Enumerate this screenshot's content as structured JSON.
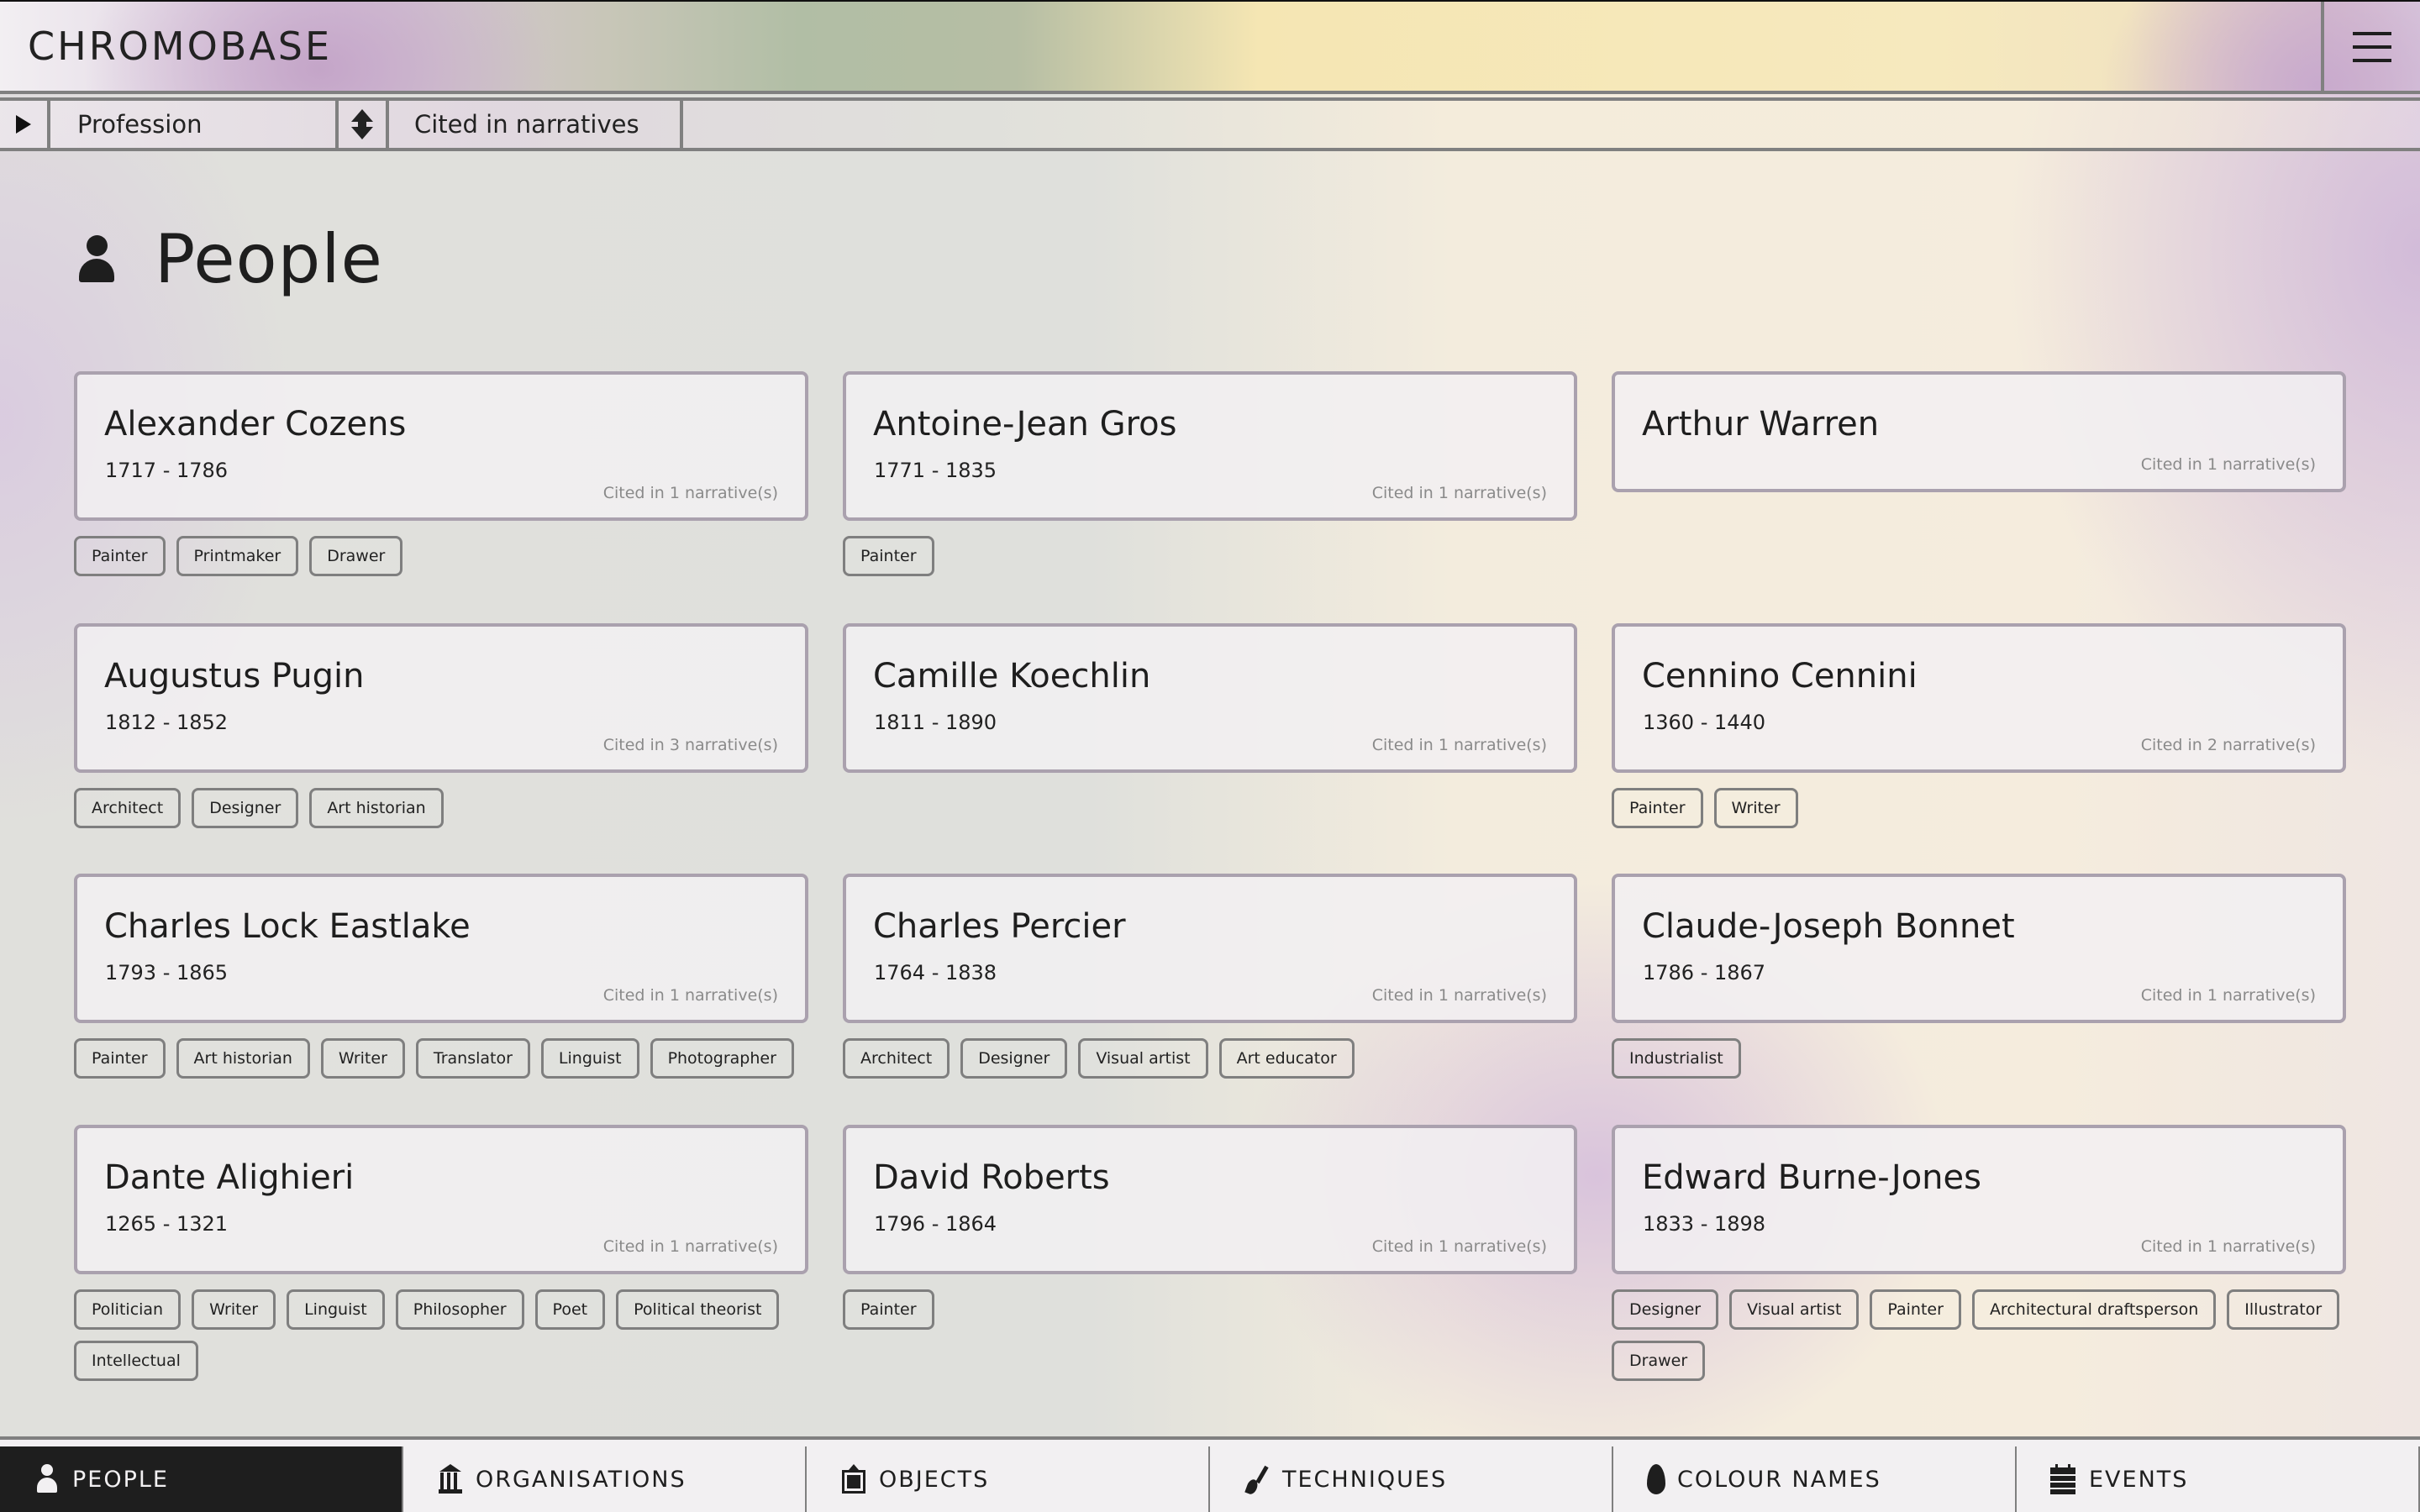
{
  "header": {
    "brand": "CHROMOBASE",
    "menu_icon": "hamburger-menu-icon"
  },
  "toolbar": {
    "play_icon": "play-triangle-icon",
    "profession_label": "Profession",
    "sort_icon": "sort-up-down-icon",
    "cited_label": "Cited in narratives"
  },
  "page": {
    "title": "People",
    "icon": "person-icon"
  },
  "people": [
    {
      "name": "Alexander Cozens",
      "years": "1717 - 1786",
      "cited": "Cited in 1 narrative(s)",
      "tags": [
        "Painter",
        "Printmaker",
        "Drawer"
      ]
    },
    {
      "name": "Antoine-Jean Gros",
      "years": "1771 - 1835",
      "cited": "Cited in 1 narrative(s)",
      "tags": [
        "Painter"
      ]
    },
    {
      "name": "Arthur Warren",
      "years": "",
      "cited": "Cited in 1 narrative(s)",
      "tags": []
    },
    {
      "name": "Augustus Pugin",
      "years": "1812 - 1852",
      "cited": "Cited in 3 narrative(s)",
      "tags": [
        "Architect",
        "Designer",
        "Art historian"
      ]
    },
    {
      "name": "Camille Koechlin",
      "years": "1811 - 1890",
      "cited": "Cited in 1 narrative(s)",
      "tags": []
    },
    {
      "name": "Cennino Cennini",
      "years": "1360 - 1440",
      "cited": "Cited in 2 narrative(s)",
      "tags": [
        "Painter",
        "Writer"
      ]
    },
    {
      "name": "Charles Lock Eastlake",
      "years": "1793 - 1865",
      "cited": "Cited in 1 narrative(s)",
      "tags": [
        "Painter",
        "Art historian",
        "Writer",
        "Translator",
        "Linguist",
        "Photographer"
      ]
    },
    {
      "name": "Charles Percier",
      "years": "1764 - 1838",
      "cited": "Cited in 1 narrative(s)",
      "tags": [
        "Architect",
        "Designer",
        "Visual artist",
        "Art educator"
      ]
    },
    {
      "name": "Claude-Joseph Bonnet",
      "years": "1786 - 1867",
      "cited": "Cited in 1 narrative(s)",
      "tags": [
        "Industrialist"
      ]
    },
    {
      "name": "Dante Alighieri",
      "years": "1265 - 1321",
      "cited": "Cited in 1 narrative(s)",
      "tags": [
        "Politician",
        "Writer",
        "Linguist",
        "Philosopher",
        "Poet",
        "Political theorist",
        "Intellectual"
      ]
    },
    {
      "name": "David Roberts",
      "years": "1796 - 1864",
      "cited": "Cited in 1 narrative(s)",
      "tags": [
        "Painter"
      ]
    },
    {
      "name": "Edward Burne-Jones",
      "years": "1833 - 1898",
      "cited": "Cited in 1 narrative(s)",
      "tags": [
        "Designer",
        "Visual artist",
        "Painter",
        "Architectural draftsperson",
        "Illustrator",
        "Drawer"
      ]
    }
  ],
  "bottom_nav": [
    {
      "label": "PEOPLE",
      "icon": "person-icon",
      "active": true
    },
    {
      "label": "ORGANISATIONS",
      "icon": "building-columns-icon",
      "active": false
    },
    {
      "label": "OBJECTS",
      "icon": "framed-picture-icon",
      "active": false
    },
    {
      "label": "TECHNIQUES",
      "icon": "paintbrush-icon",
      "active": false
    },
    {
      "label": "COLOUR NAMES",
      "icon": "paint-drop-icon",
      "active": false
    },
    {
      "label": "EVENTS",
      "icon": "calendar-icon",
      "active": false
    }
  ],
  "colors": {
    "text": "#1e1e1e",
    "border": "#808080",
    "card_border": "#aaa1ae",
    "active_tab_bg": "#1e1e1e"
  }
}
